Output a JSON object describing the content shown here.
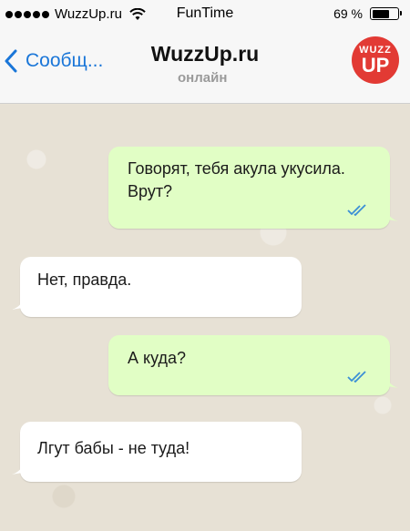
{
  "status_bar": {
    "carrier": "WuzzUp.ru",
    "time": "FunTime",
    "battery": "69 %",
    "battery_level": 0.69
  },
  "nav": {
    "back_label": "Сообщ...",
    "title": "WuzzUp.ru",
    "subtitle": "онлайн",
    "avatar_top": "WUZZ",
    "avatar_bottom": "UP",
    "avatar_color": "#e23a34",
    "accent_color": "#1a76d8"
  },
  "messages": [
    {
      "direction": "outgoing",
      "text": "Говорят, тебя акула укусила. Врут?",
      "status": "read"
    },
    {
      "direction": "incoming",
      "text": "Нет, правда."
    },
    {
      "direction": "outgoing",
      "text": "А куда?",
      "status": "read"
    },
    {
      "direction": "incoming",
      "text": "Лгут бабы - не туда!"
    }
  ],
  "colors": {
    "outgoing_bubble": "#e1fec5",
    "incoming_bubble": "#ffffff",
    "read_check": "#3b8fd6"
  }
}
